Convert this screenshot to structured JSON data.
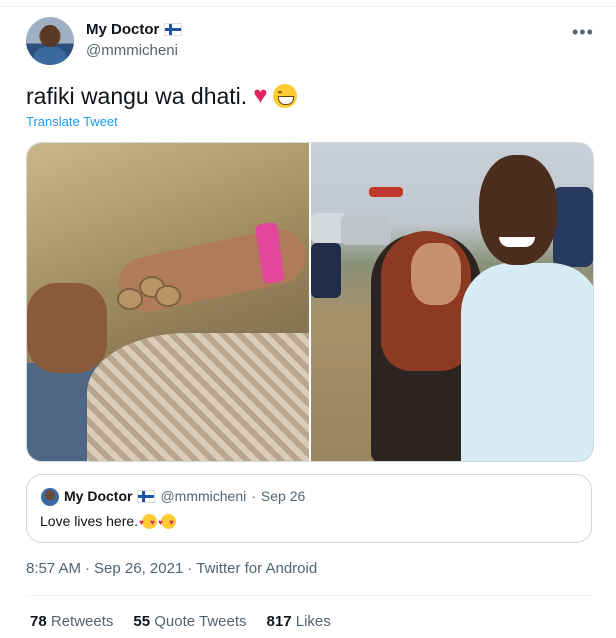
{
  "author": {
    "name": "My Doctor",
    "handle": "@mmmicheni",
    "flag_icon": "finland-flag-icon",
    "avatar_icon": "profile-avatar"
  },
  "more_icon": "more-options-icon",
  "tweet": {
    "text": "rafiki wangu wa dhati.",
    "emojis": [
      "red-heart-emoji",
      "grinning-face-emoji"
    ],
    "translate_label": "Translate Tweet",
    "photos": [
      "photo-hand-with-coins",
      "photo-couple-selfie"
    ]
  },
  "quoted": {
    "name": "My Doctor",
    "handle": "@mmmicheni",
    "separator": "·",
    "date": "Sep 26",
    "text": "Love lives here.",
    "emojis": [
      "smiling-face-with-hearts-emoji",
      "smiling-face-with-hearts-emoji"
    ]
  },
  "meta": {
    "time": "8:57 AM",
    "sep1": "·",
    "date": "Sep 26, 2021",
    "sep2": "·",
    "source": "Twitter for Android"
  },
  "stats": {
    "retweets_count": "78",
    "retweets_label": "Retweets",
    "quotes_count": "55",
    "quotes_label": "Quote Tweets",
    "likes_count": "817",
    "likes_label": "Likes"
  },
  "colors": {
    "link": "#1d9bf0",
    "secondary_text": "#536471",
    "primary_text": "#0f1419",
    "heart": "#e0245e"
  }
}
